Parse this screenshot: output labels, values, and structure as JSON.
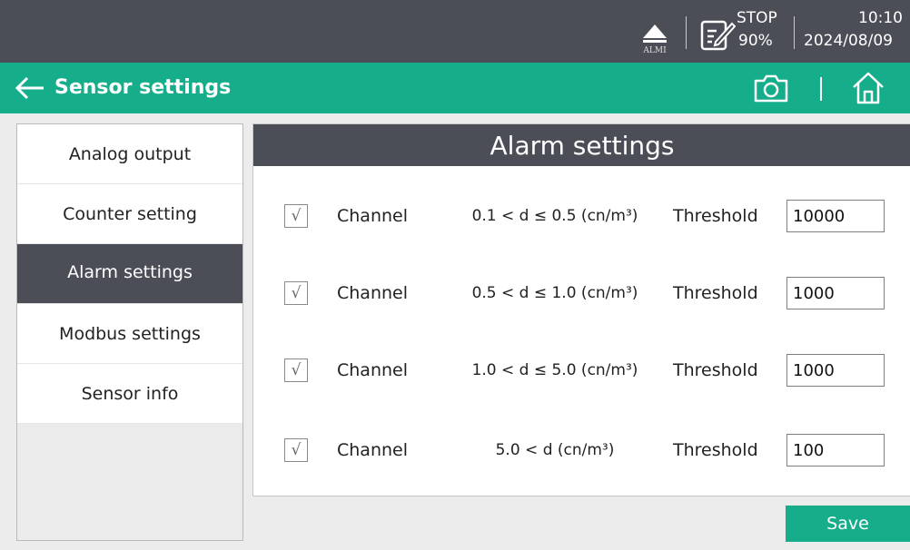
{
  "status": {
    "alarm_label": "ALMI",
    "run_state": "STOP",
    "battery": "90%",
    "time": "10:10",
    "date": "2024/08/09",
    "alarm_icon": "alarm-triangle-icon",
    "note_icon": "edit-note-icon"
  },
  "header": {
    "title": "Sensor settings",
    "back_icon": "arrow-left-icon",
    "camera_icon": "camera-icon",
    "home_icon": "home-icon"
  },
  "sidebar": {
    "items": [
      {
        "label": "Analog output"
      },
      {
        "label": "Counter setting"
      },
      {
        "label": "Alarm settings"
      },
      {
        "label": "Modbus settings"
      },
      {
        "label": "Sensor info"
      }
    ],
    "active_index": 2
  },
  "main": {
    "title": "Alarm settings",
    "check_mark": "√",
    "rows": [
      {
        "channel_label": "Channel",
        "range": "0.1 < d ≤ 0.5 (cn/m³)",
        "threshold_label": "Threshold",
        "threshold": "10000",
        "checked": true
      },
      {
        "channel_label": "Channel",
        "range": "0.5 < d ≤ 1.0 (cn/m³)",
        "threshold_label": "Threshold",
        "threshold": "1000",
        "checked": true
      },
      {
        "channel_label": "Channel",
        "range": "1.0 < d ≤ 5.0 (cn/m³)",
        "threshold_label": "Threshold",
        "threshold": "1000",
        "checked": true
      },
      {
        "channel_label": "Channel",
        "range": "5.0 < d (cn/m³)",
        "threshold_label": "Threshold",
        "threshold": "100",
        "checked": true
      }
    ]
  },
  "actions": {
    "save_label": "Save"
  },
  "colors": {
    "accent": "#16ad8b",
    "dark": "#4c4e57"
  }
}
